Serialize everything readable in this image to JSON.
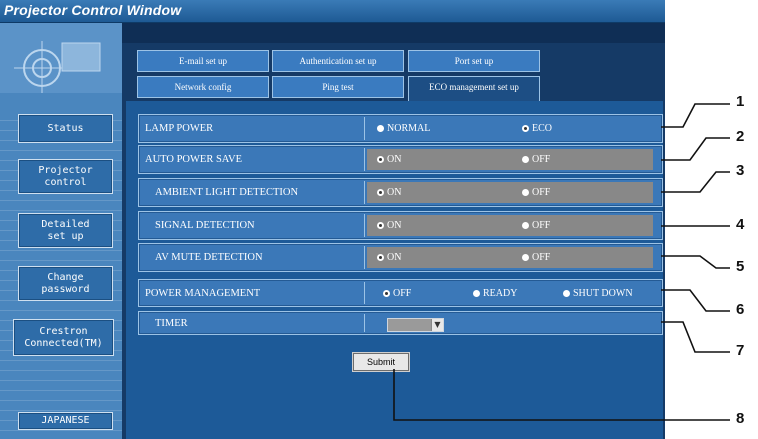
{
  "window": {
    "title": "Projector Control Window"
  },
  "sidebar": {
    "buttons": [
      {
        "label": "Status"
      },
      {
        "label": "Projector\ncontrol"
      },
      {
        "label": "Detailed\nset up"
      },
      {
        "label": "Change\npassword"
      },
      {
        "label": "Crestron\nConnected(TM)"
      },
      {
        "label": "JAPANESE"
      }
    ]
  },
  "tabs": [
    {
      "label": "E-mail set up"
    },
    {
      "label": "Authentication set up"
    },
    {
      "label": "Port set up"
    },
    {
      "label": "Network config"
    },
    {
      "label": "Ping test"
    },
    {
      "label": "ECO management set up"
    }
  ],
  "settings": [
    {
      "label": "LAMP POWER",
      "options": [
        {
          "label": "NORMAL",
          "selected": false
        },
        {
          "label": "ECO",
          "selected": true
        }
      ]
    },
    {
      "label": "AUTO POWER SAVE",
      "options": [
        {
          "label": "ON",
          "selected": true
        },
        {
          "label": "OFF",
          "selected": false
        }
      ]
    },
    {
      "label": "AMBIENT LIGHT DETECTION",
      "options": [
        {
          "label": "ON",
          "selected": true
        },
        {
          "label": "OFF",
          "selected": false
        }
      ]
    },
    {
      "label": "SIGNAL DETECTION",
      "options": [
        {
          "label": "ON",
          "selected": true
        },
        {
          "label": "OFF",
          "selected": false
        }
      ]
    },
    {
      "label": "AV MUTE DETECTION",
      "options": [
        {
          "label": "ON",
          "selected": true
        },
        {
          "label": "OFF",
          "selected": false
        }
      ]
    },
    {
      "label": "POWER MANAGEMENT",
      "options": [
        {
          "label": "OFF",
          "selected": true
        },
        {
          "label": "READY",
          "selected": false
        },
        {
          "label": "SHUT DOWN",
          "selected": false
        }
      ]
    },
    {
      "label": "TIMER",
      "value": ""
    }
  ],
  "submit_label": "Submit",
  "callouts": [
    "1",
    "2",
    "3",
    "4",
    "5",
    "6",
    "7",
    "8"
  ],
  "colors": {
    "title_bar": "#1e5a94",
    "sidebar": "#4a86be",
    "panel": "#153a66",
    "row": "#3b78b8",
    "disabled_field": "#888888"
  }
}
